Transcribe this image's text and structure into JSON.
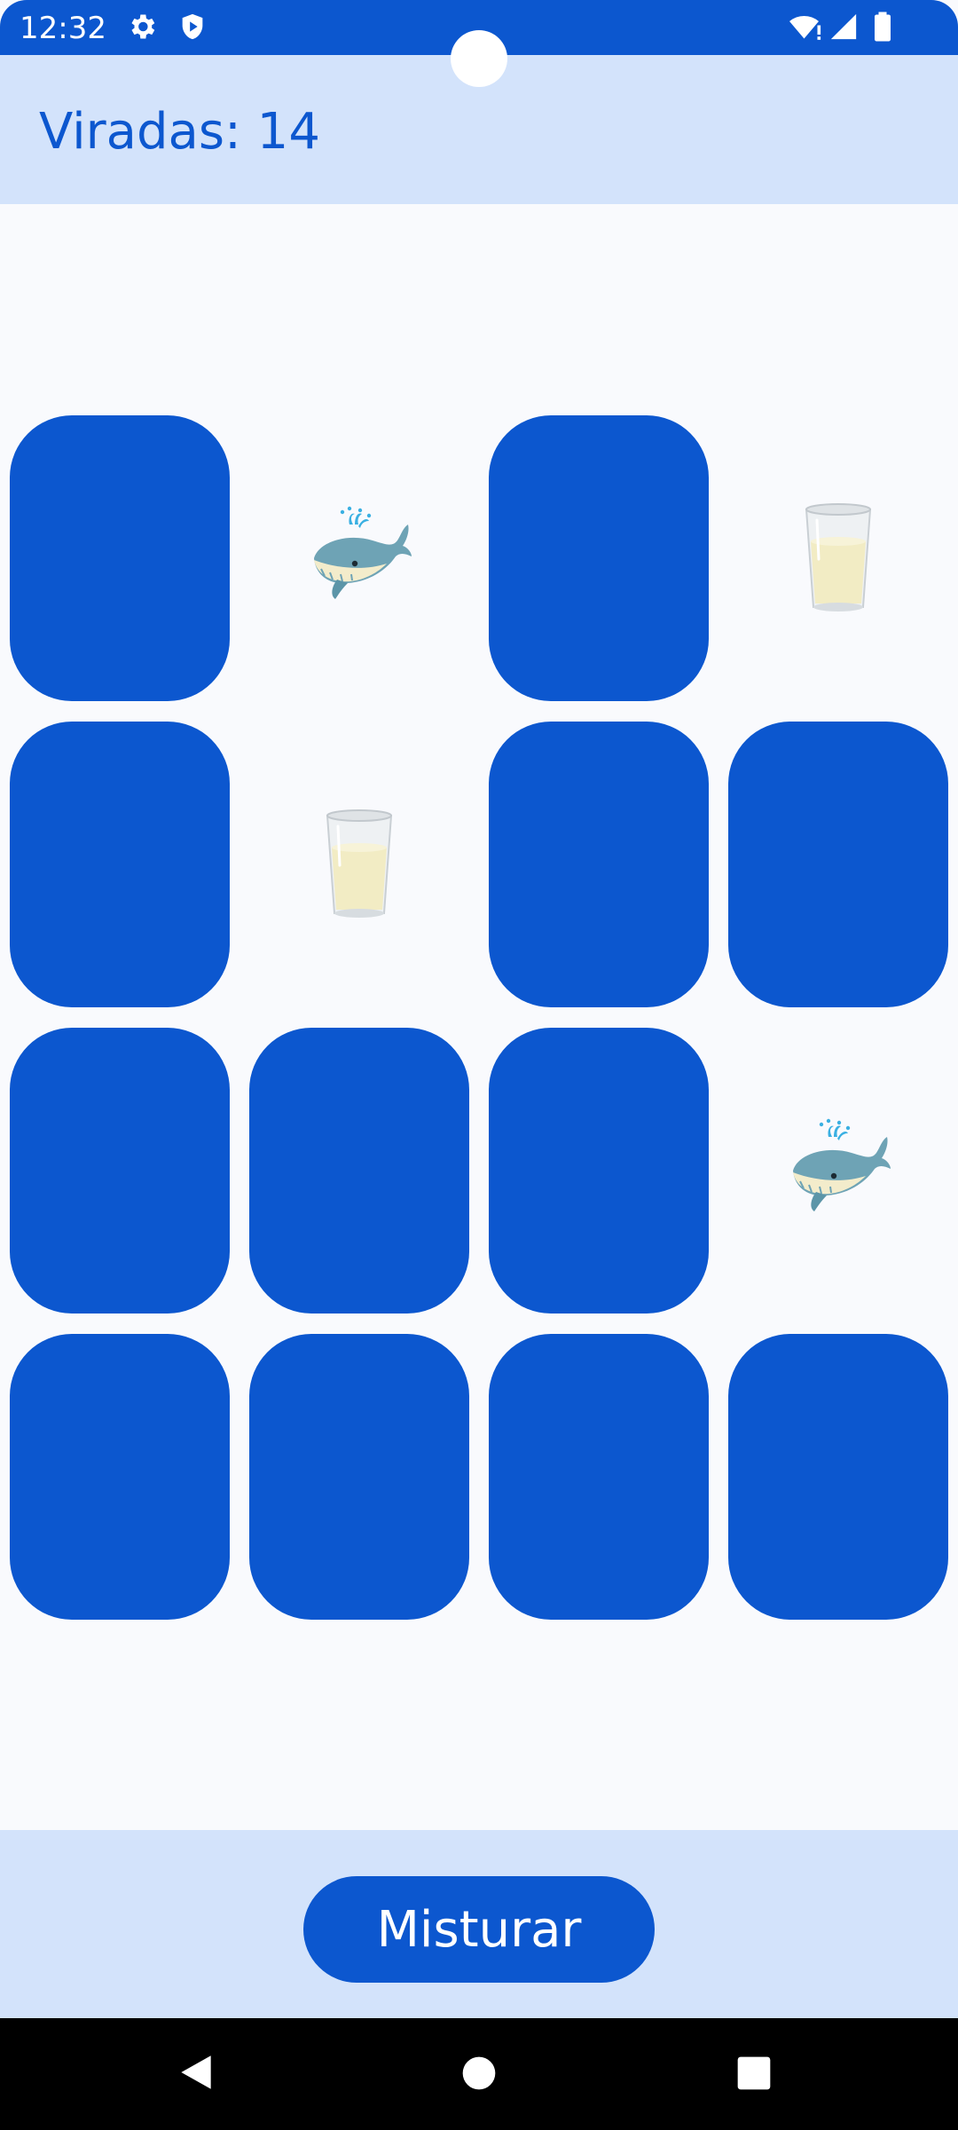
{
  "status_bar": {
    "time": "12:32",
    "icons_left": [
      "gear-icon",
      "shield-play-icon"
    ],
    "icons_right": [
      "wifi-alert-icon",
      "signal-icon",
      "battery-icon"
    ]
  },
  "header": {
    "flips_label": "Viradas: 14"
  },
  "board": {
    "columns": 4,
    "rows": 4,
    "cards": [
      {
        "state": "hidden"
      },
      {
        "state": "revealed",
        "emoji": "whale-icon"
      },
      {
        "state": "hidden"
      },
      {
        "state": "revealed",
        "emoji": "milk-glass-icon"
      },
      {
        "state": "hidden"
      },
      {
        "state": "revealed",
        "emoji": "milk-glass-icon"
      },
      {
        "state": "hidden"
      },
      {
        "state": "hidden"
      },
      {
        "state": "hidden"
      },
      {
        "state": "hidden"
      },
      {
        "state": "hidden"
      },
      {
        "state": "revealed",
        "emoji": "whale-icon"
      },
      {
        "state": "hidden"
      },
      {
        "state": "hidden"
      },
      {
        "state": "hidden"
      },
      {
        "state": "hidden"
      }
    ]
  },
  "footer": {
    "shuffle_label": "Misturar"
  },
  "navigation": {
    "buttons": [
      "back-icon",
      "home-icon",
      "recents-icon"
    ]
  },
  "colors": {
    "primary": "#0c57cf",
    "surface_tint": "#d3e3fb",
    "background": "#f9fafd"
  }
}
